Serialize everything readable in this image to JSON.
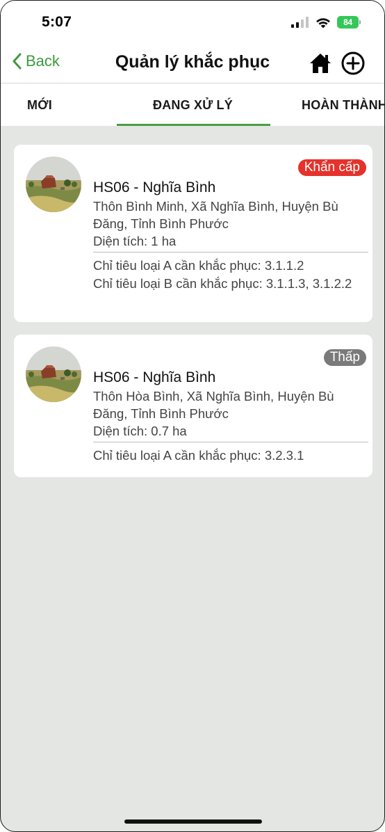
{
  "status_bar": {
    "time": "5:07",
    "battery": "84"
  },
  "nav": {
    "back_label": "Back",
    "title": "Quản lý khắc phục"
  },
  "tabs": [
    {
      "label": "MỚI"
    },
    {
      "label": "ĐANG XỬ LÝ",
      "active": true
    },
    {
      "label": "HOÀN THÀNH"
    }
  ],
  "cards": [
    {
      "title": "HS06 - Nghĩa Bình",
      "address": "Thôn Bình Minh, Xã Nghĩa Bình, Huyện Bù Đăng, Tỉnh Bình Phước",
      "area": "Diện tích: 1 ha",
      "badge": "Khẩn cấp",
      "badge_color": "#e5322a",
      "criteria": [
        "Chỉ tiêu loại A cần khắc phục: 3.1.1.2",
        "Chỉ tiêu loại B cần khắc phục: 3.1.1.3, 3.1.2.2"
      ]
    },
    {
      "title": "HS06 - Nghĩa Bình",
      "address": "Thôn Hòa Bình, Xã Nghĩa Bình, Huyện Bù Đăng, Tỉnh Bình Phước",
      "area": "Diện tích: 0.7 ha",
      "badge": "Thấp",
      "badge_color": "#7a7a7a",
      "criteria": [
        "Chỉ tiêu loại A cần khắc phục: 3.2.3.1"
      ]
    }
  ],
  "colors": {
    "accent": "#4a9e45",
    "background": "#e4e6e3"
  }
}
